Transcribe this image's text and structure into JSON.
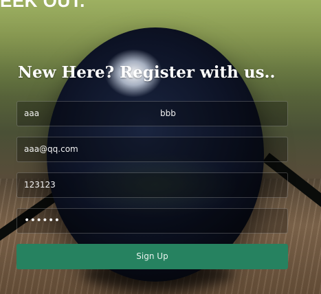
{
  "header": {
    "partial_heading": "EEK OUT."
  },
  "register_form": {
    "title": "New Here? Register with us..",
    "first_name_value": "aaa",
    "last_name_value": "bbb",
    "email_value": "aaa@qq.com",
    "phone_value": "123123",
    "password_masked": "••••••",
    "submit_label": "Sign Up"
  },
  "colors": {
    "button_bg": "#268260",
    "text": "#ffffff"
  }
}
